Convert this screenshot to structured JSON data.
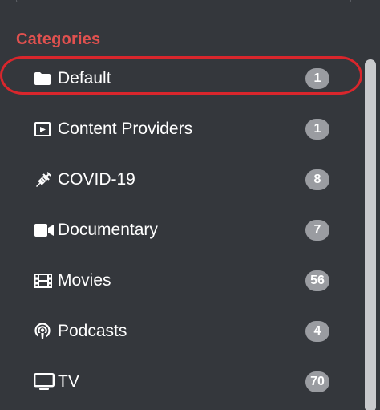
{
  "categories": {
    "heading": "Categories",
    "items": [
      {
        "label": "Default",
        "count": "1",
        "icon": "folder-icon"
      },
      {
        "label": "Content Providers",
        "count": "1",
        "icon": "play-square-icon"
      },
      {
        "label": "COVID-19",
        "count": "8",
        "icon": "syringe-icon"
      },
      {
        "label": "Documentary",
        "count": "7",
        "icon": "video-camera-icon"
      },
      {
        "label": "Movies",
        "count": "56",
        "icon": "film-icon"
      },
      {
        "label": "Podcasts",
        "count": "4",
        "icon": "podcast-icon"
      },
      {
        "label": "TV",
        "count": "70",
        "icon": "tv-icon"
      }
    ]
  },
  "colors": {
    "heading": "#e0514f",
    "badge": "#9a9ca1",
    "highlight": "#d9262c",
    "background": "#34373c"
  }
}
